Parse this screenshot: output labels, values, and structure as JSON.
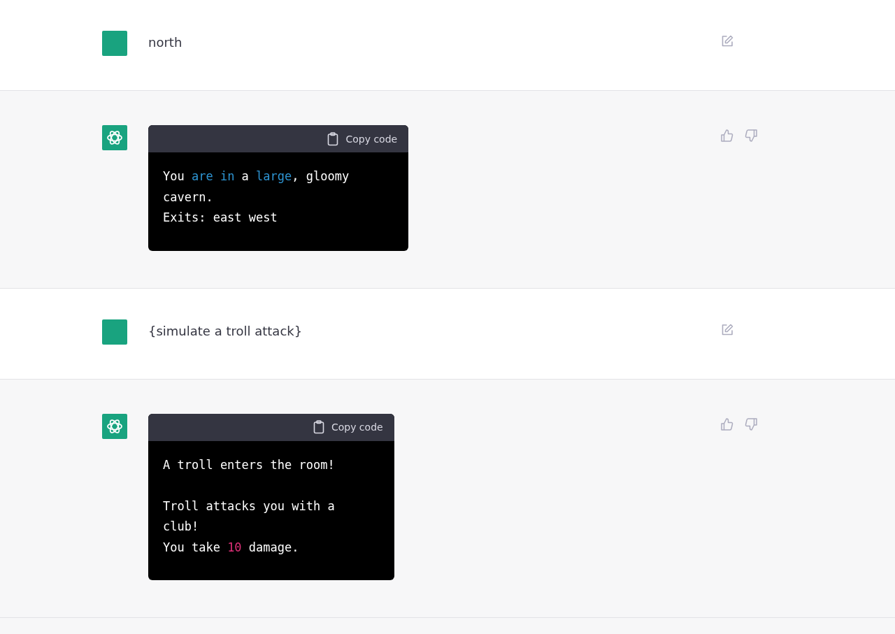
{
  "messages": [
    {
      "kind": "user",
      "text": "north"
    },
    {
      "kind": "assistant",
      "copy_label": "Copy code",
      "paragraphs": [
        [
          [
            {
              "kind": "plain",
              "text": "You "
            },
            {
              "kind": "keyword",
              "text": "are in"
            },
            {
              "kind": "plain",
              "text": " a "
            },
            {
              "kind": "keyword",
              "text": "large"
            },
            {
              "kind": "plain",
              "text": ", gloomy"
            }
          ],
          [
            {
              "kind": "plain",
              "text": "cavern."
            }
          ],
          [
            {
              "kind": "plain",
              "text": "Exits: east west"
            }
          ]
        ]
      ]
    },
    {
      "kind": "user",
      "text": "{simulate a troll attack}"
    },
    {
      "kind": "assistant",
      "copy_label": "Copy code",
      "paragraphs": [
        [
          [
            {
              "kind": "plain",
              "text": "A troll enters the room!"
            }
          ]
        ],
        [
          [
            {
              "kind": "plain",
              "text": "Troll attacks you with a"
            }
          ],
          [
            {
              "kind": "plain",
              "text": "club!"
            }
          ],
          [
            {
              "kind": "plain",
              "text": "You take "
            },
            {
              "kind": "number",
              "text": "10"
            },
            {
              "kind": "plain",
              "text": " damage."
            }
          ]
        ]
      ]
    }
  ]
}
